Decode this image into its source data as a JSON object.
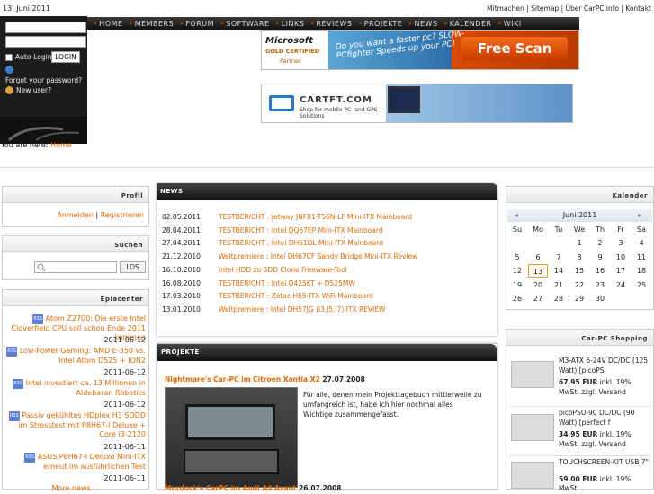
{
  "date": "13. Juni 2011",
  "top_links": [
    "Mitmachen",
    "Sitemap",
    "Über CarPC.info",
    "Kontakt"
  ],
  "login": {
    "auto_login": "Auto-Login",
    "login_btn": "LOGIN",
    "forgot": "Forgot your password?",
    "new_user": "New user?"
  },
  "nav": [
    "HOME",
    "MEMBERS",
    "FORUM",
    "SOFTWARE",
    "LINKS",
    "REVIEWS",
    "PROJEKTE",
    "NEWS",
    "KALENDER",
    "WIKI"
  ],
  "ad1": {
    "brand": "Microsoft",
    "sub": "GOLD CERTIFIED",
    "partner": "Partner",
    "slogan": "Do you want a faster pc? SLOW-PCfighter Speeds up your PC!",
    "cta": "Free Scan"
  },
  "ad2": {
    "brand": "CARTFT.COM",
    "sub": "Shop for mobile PC- and GPS-Solutions"
  },
  "breadcrumb": {
    "prefix": "You are here:",
    "home": "Home"
  },
  "profil": {
    "title": "Profil",
    "login": "Anmelden",
    "register": "Registrieren"
  },
  "suchen": {
    "title": "Suchen",
    "button": "LOS"
  },
  "epia": {
    "title": "Epiacenter",
    "items": [
      {
        "text": "Atom Z2700: Die erste Intel Cloverfield CPU soll schon Ende 2011 kommen",
        "date": "2011-06-12"
      },
      {
        "text": "Low-Power-Gaming: AMD E-350 vs. Intel Atom D525 + ION2",
        "date": "2011-06-12"
      },
      {
        "text": "Intel investiert ca. 13 Millionen in Aldebaran Robotics",
        "date": "2011-06-12"
      },
      {
        "text": "Passiv gekühltes HDplex H3 SODD im Stresstest mit P8H67-I Deluxe + Core i3-2120",
        "date": "2011-06-11"
      },
      {
        "text": "ASUS P8H67-I Deluxe Mini-ITX erneut im ausführlichen Test",
        "date": "2011-06-11"
      }
    ],
    "more": "More news..."
  },
  "news": {
    "title": "NEWS",
    "rows": [
      {
        "date": "02.05.2011",
        "text": "TESTBERICHT : Jetway JNF81-T56N-LF Mini-ITX Mainboard"
      },
      {
        "date": "28.04.2011",
        "text": "TESTBERICHT : Intel DQ67EP Mini-ITX Mainboard"
      },
      {
        "date": "27.04.2011",
        "text": "TESTBERICHT : Intel DH61DL Mini-ITX Mainboard"
      },
      {
        "date": "21.12.2010",
        "text": "Weltpremiere : Intel DH67CF Sandy Bridge Mini-ITX Review"
      },
      {
        "date": "16.10.2010",
        "text": "Intel HDD zu SDD Clone Freeware-Tool"
      },
      {
        "date": "16.08.2010",
        "text": "TESTBERICHT : Intel D425KT + D525MW"
      },
      {
        "date": "17.03.2010",
        "text": "TESTBERICHT : Zotac H55-ITX WiFi Mainboard"
      },
      {
        "date": "13.01.2010",
        "text": "Weltpremiere : Intel DH57JG (i3,i5,i7) ITX REVIEW"
      }
    ]
  },
  "projekte": {
    "title": "PROJEKTE",
    "entry_title": "Nightmare's Car-PC im Citroen Xantia X2",
    "entry_date": "27.07.2008",
    "entry_text": "Für alle, denen mein Projekttagebuch mittlerweile zu umfangreich ist, habe ich hier nochmal alles Wichtige zusammengefasst.",
    "entry2_title": "Murdock's CarPC im Audi A4 Avant",
    "entry2_date": "26.07.2008"
  },
  "kalender": {
    "title": "Kalender",
    "month": "Juni 2011",
    "weekdays": [
      "Su",
      "Mo",
      "Tu",
      "We",
      "Th",
      "Fr",
      "Sa"
    ],
    "weeks": [
      [
        "",
        "",
        "",
        "1",
        "2",
        "3",
        "4"
      ],
      [
        "5",
        "6",
        "7",
        "8",
        "9",
        "10",
        "11"
      ],
      [
        "12",
        "13",
        "14",
        "15",
        "16",
        "17",
        "18"
      ],
      [
        "19",
        "20",
        "21",
        "22",
        "23",
        "24",
        "25"
      ],
      [
        "26",
        "27",
        "28",
        "29",
        "30",
        "",
        ""
      ]
    ],
    "today": "13"
  },
  "shop": {
    "title": "Car-PC Shopping",
    "items": [
      {
        "name": "M3-ATX 6-24V DC/DC (125 Watt) [picoPS",
        "price": "67.95 EUR",
        "tax": "inkl. 19% MwSt. zzgl. Versand"
      },
      {
        "name": "picoPSU-90 DC/DC (90 Watt) [perfect f",
        "price": "34.95 EUR",
        "tax": "inkl. 19% MwSt. zzgl. Versand"
      },
      {
        "name": "TOUCHSCREEN-KIT USB 7\"",
        "price": "59.00 EUR",
        "tax": "inkl. 19% MwSt."
      }
    ]
  }
}
